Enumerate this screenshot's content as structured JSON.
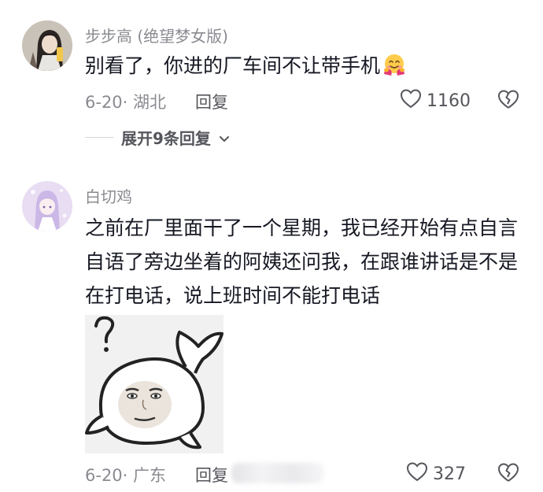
{
  "comments": [
    {
      "username": "步步高 (绝望梦女版)",
      "text": "别看了，你进的厂车间不让带手机",
      "emoji": "hugging-face-icon",
      "date_location": "6-20· 湖北",
      "reply_label": "回复",
      "like_count": "1160",
      "expand_label": "展开9条回复"
    },
    {
      "username": "白切鸡",
      "text": "之前在厂里面干了一个星期，我已经开始有点自言自语了旁边坐着的阿姨还问我，在跟谁讲话是不是在打电话，说上班时间不能打电话",
      "sticker": "confused-whale-meme-sticker",
      "date_location": "6-20· 广东",
      "reply_label": "回复",
      "like_count": "327"
    }
  ],
  "colors": {
    "primary_text": "#161823",
    "secondary_text": "#8a8b91",
    "action_text": "#55565c"
  }
}
